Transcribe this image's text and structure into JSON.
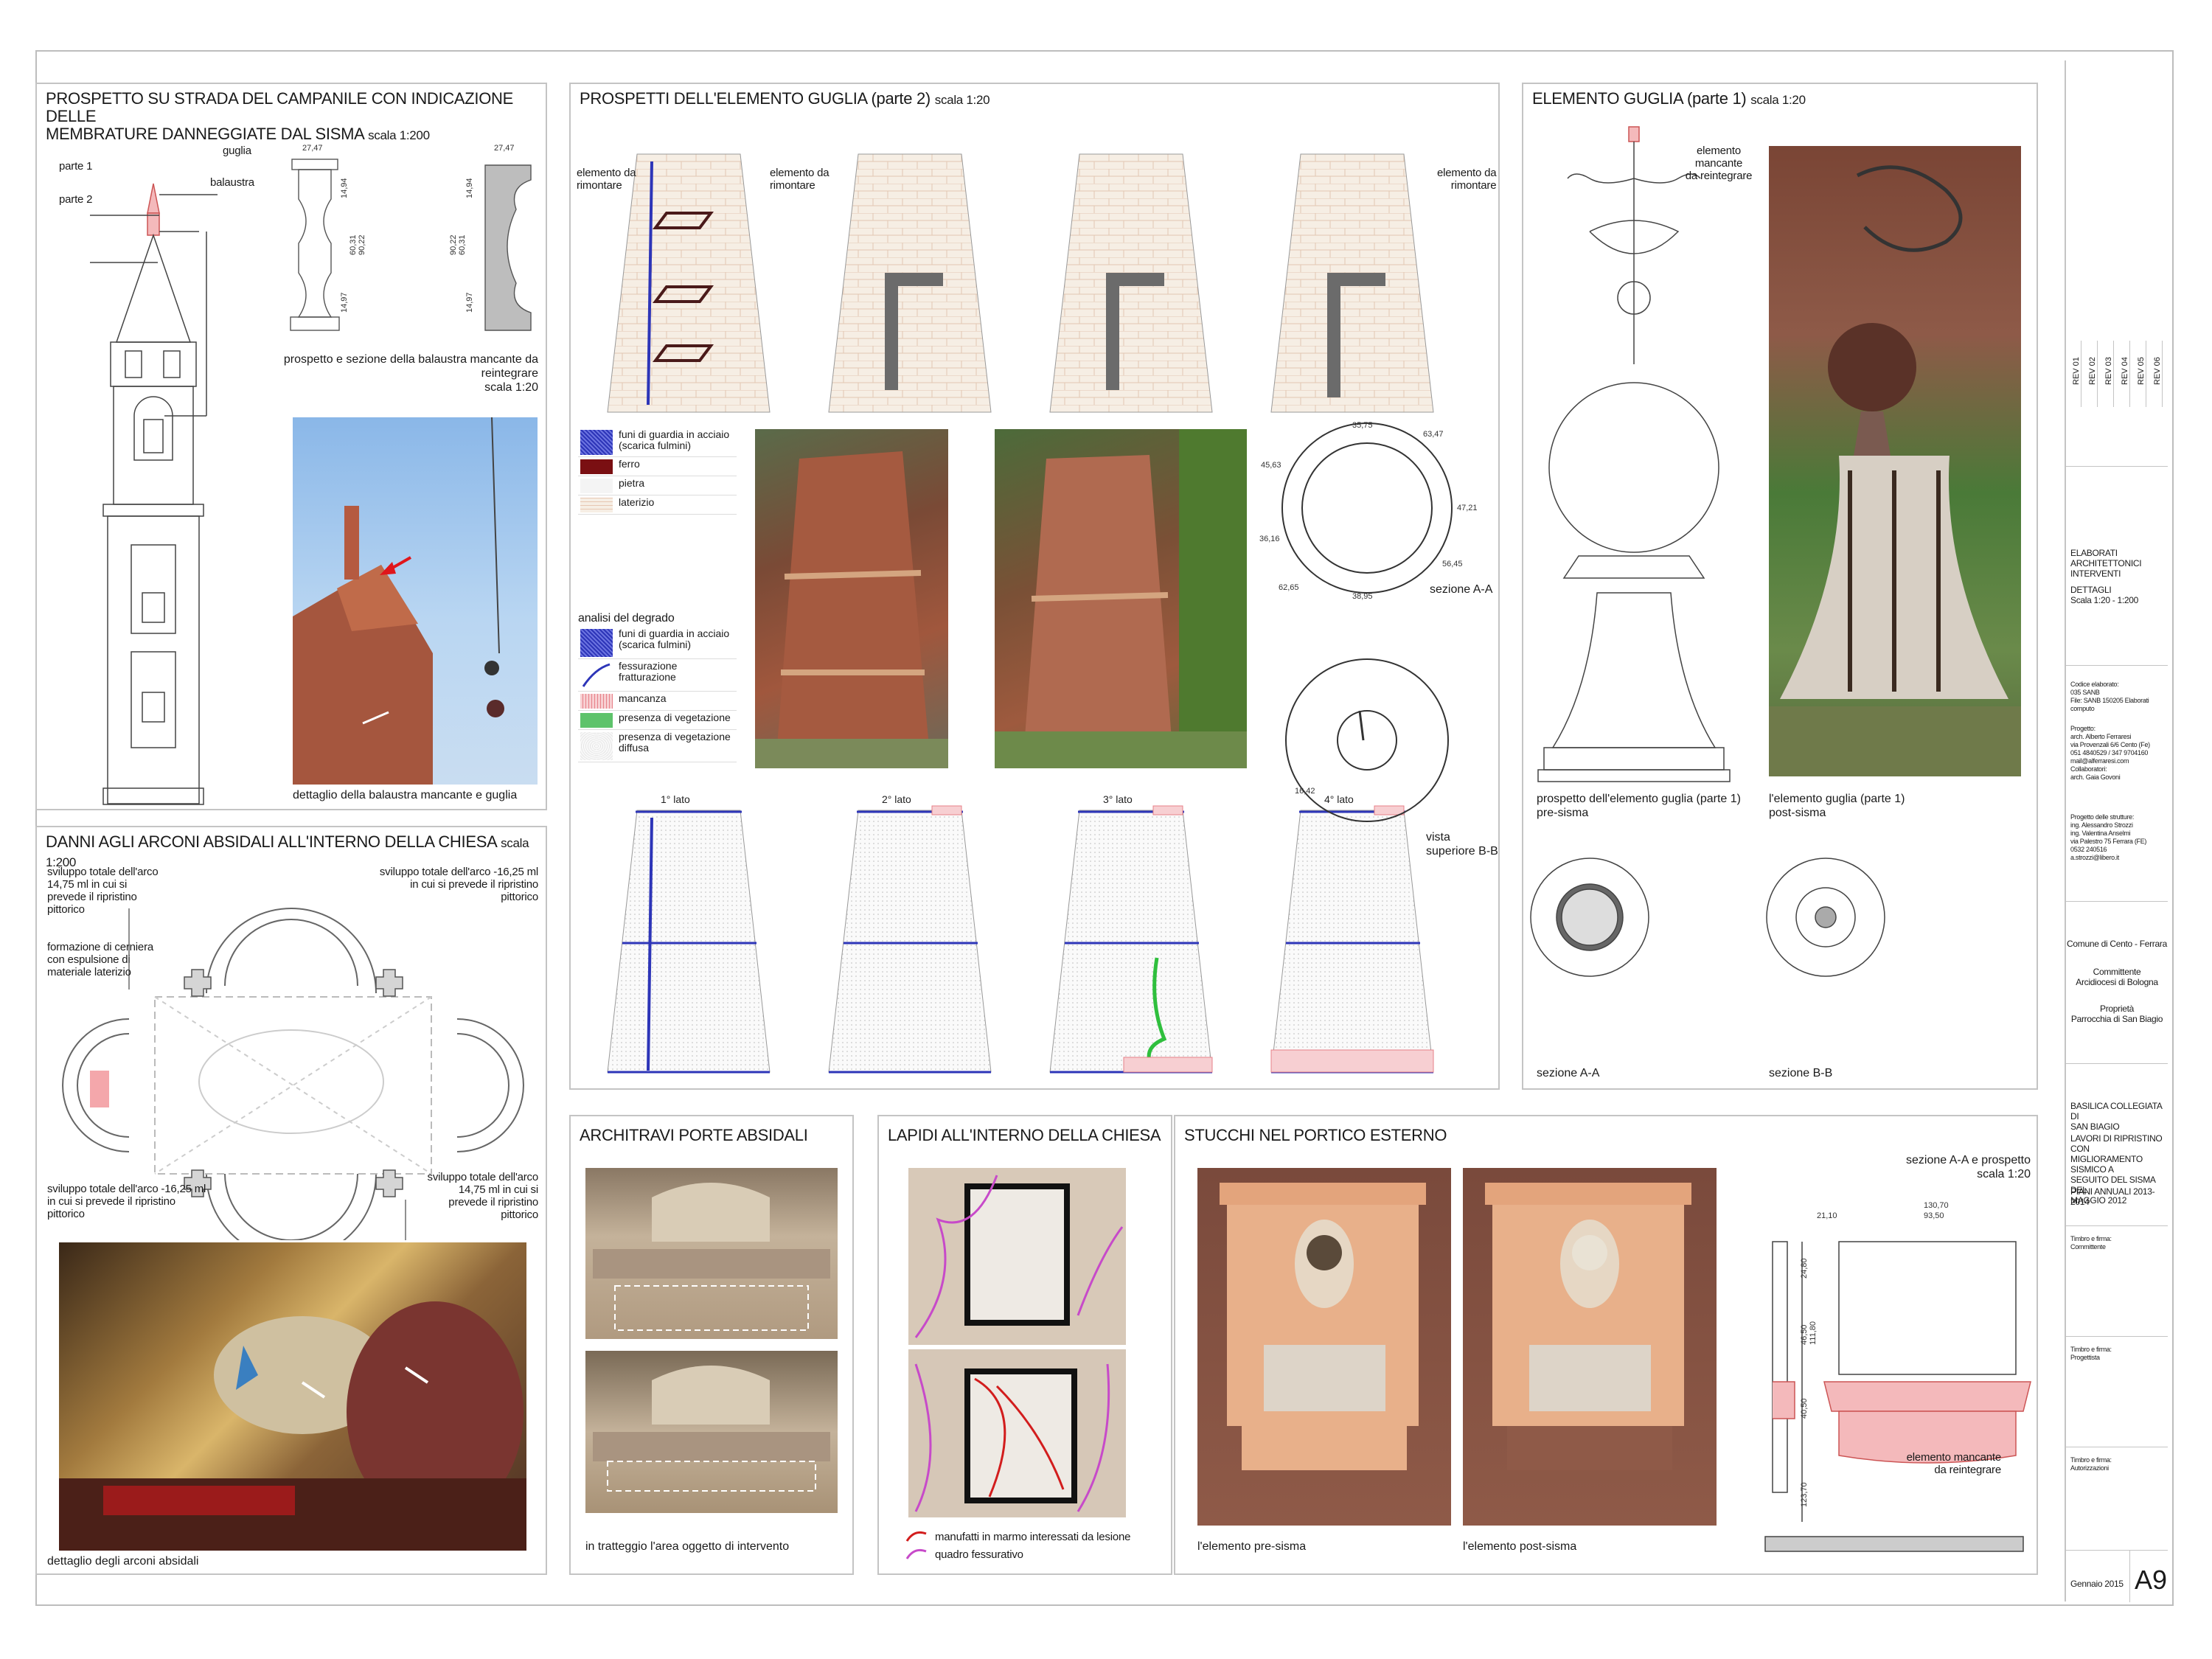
{
  "panel1": {
    "title_line1": "PROSPETTO SU STRADA DEL CAMPANILE CON INDICAZIONE DELLE",
    "title_line2": "MEMBRATURE DANNEGGIATE DAL SISMA",
    "scale": "scala 1:200",
    "labels": {
      "guglia": "guglia",
      "parte1": "parte 1",
      "parte2": "parte 2",
      "balaustra": "balaustra"
    },
    "dims": {
      "d1": "27,47",
      "d2": "27,47",
      "v1": "14,94",
      "v2": "60,31",
      "v3": "90,22",
      "v4": "14,97",
      "v5": "14,94",
      "v6": "90,22",
      "v7": "60,31",
      "v8": "14,97"
    },
    "balaustra_caption1": "prospetto e sezione della balaustra mancante da reintegrare",
    "balaustra_caption2": "scala 1:20",
    "photo_caption": "dettaglio della balaustra mancante e guglia"
  },
  "panel2": {
    "title": "DANNI AGLI ARCONI ABSIDALI ALL'INTERNO DELLA CHIESA",
    "scale": "scala 1:200",
    "note_tl": [
      "sviluppo totale dell'arco",
      "14,75 ml in cui si",
      "prevede il ripristino",
      "pittorico"
    ],
    "note_tr": [
      "sviluppo totale dell'arco -16,25 ml",
      "in cui si prevede il ripristino",
      "pittorico"
    ],
    "note_ml": [
      "formazione di cerniera",
      "con espulsione di",
      "materiale laterizio"
    ],
    "note_bl": [
      "sviluppo totale dell'arco -16,25 ml",
      "in cui si prevede il ripristino",
      "pittorico"
    ],
    "note_br": [
      "sviluppo totale dell'arco",
      "14,75 ml in cui si",
      "prevede il ripristino",
      "pittorico"
    ],
    "photo_caption": "dettaglio degli arconi absidali"
  },
  "panel3": {
    "title": "PROSPETTI  DELL'ELEMENTO GUGLIA (parte 2)",
    "scale": "scala 1:20",
    "sides": [
      "1° lato",
      "2° lato",
      "3° lato",
      "4° lato"
    ],
    "elem_left": [
      "elemento da",
      "rimontare"
    ],
    "elem_mid": [
      "elemento da",
      "rimontare"
    ],
    "elem_right": [
      "elemento da",
      "rimontare"
    ],
    "legend1": [
      "funi di guardia in acciaio (scarica fulmini)",
      "ferro",
      "pietra",
      "laterizio"
    ],
    "analisi_title": "analisi del degrado",
    "legend2": [
      "funi di guardia in acciaio (scarica fulmini)",
      "fessurazione fratturazione",
      "mancanza",
      "presenza di vegetazione",
      "presenza di vegetazione diffusa"
    ],
    "ring_dims": [
      "35,75",
      "63,47",
      "45,63",
      "47,21",
      "36,16",
      "56,45",
      "38,95",
      "62,65"
    ],
    "sezione_aa": "sezione A-A",
    "vista": [
      "vista",
      "superiore B-B"
    ],
    "vista_dim": "16,42",
    "colors": {
      "blue": "#2d35b8",
      "iron": "#7a0f12",
      "brick": "#f6eee4",
      "red": "#e78088",
      "green": "#2fbf3d"
    }
  },
  "panel4": {
    "title": "ELEMENTO GUGLIA (parte 1)",
    "scale": "scala 1:20",
    "elem": [
      "elemento",
      "mancante",
      "da reintegrare"
    ],
    "cap_left": [
      "prospetto dell'elemento guglia (parte 1)",
      "pre-sisma"
    ],
    "cap_right": [
      "l'elemento guglia (parte 1)",
      "post-sisma"
    ],
    "sez_aa": "sezione A-A",
    "sez_bb": "sezione B-B"
  },
  "panel5": {
    "title": "ARCHITRAVI PORTE ABSIDALI",
    "caption": "in tratteggio l'area oggetto di intervento"
  },
  "panel6": {
    "title": "LAPIDI ALL'INTERNO DELLA CHIESA",
    "legend": [
      "manufatti in marmo interessati da lesione",
      "quadro fessurativo"
    ]
  },
  "panel7": {
    "title": "STUCCHI NEL PORTICO ESTERNO",
    "cap_left": "l'elemento pre-sisma",
    "cap_right": "l'elemento post-sisma",
    "sez": [
      "sezione A-A e prospetto",
      "scala 1:20"
    ],
    "dims": [
      "130,70",
      "93,50",
      "21,10",
      "24,80",
      "46,50",
      "111,80",
      "40,50",
      "123,70"
    ],
    "elem": [
      "elemento mancante",
      "da reintegrare"
    ]
  },
  "titleblock": {
    "revs": [
      "REV 01",
      "REV 02",
      "REV 03",
      "REV 04",
      "REV 05",
      "REV 06"
    ],
    "elab": [
      "ELABORATI ARCHITETTONICI",
      "INTERVENTI"
    ],
    "dettagli": [
      "DETTAGLI",
      "Scala 1:20 - 1:200"
    ],
    "codice": [
      "Codice elaborato:",
      "035 SANB",
      "File: SANB 150205 Elaborati computo"
    ],
    "progetto": [
      "Progetto:",
      "arch. Alberto Ferraresi",
      "via Provenzali 6/6 Cento (Fe)",
      "051 4840529 / 347 9704160",
      "mail@alferraresi.com",
      "Collaboratori:",
      "arch. Gaia Govoni"
    ],
    "strutture": [
      "Progetto delle strutture:",
      "ing. Alessandro Strozzi",
      "ing. Valentina Anselmi",
      "via Palestro 75 Ferrara (FE)",
      "0532 240516",
      "a.strozzi@libero.it"
    ],
    "comune": "Comune di Cento - Ferrara",
    "committente": [
      "Committente",
      "Arcidiocesi di Bologna"
    ],
    "proprieta": [
      "Proprietà",
      "Parrocchia di San Biagio"
    ],
    "basilica": [
      "BASILICA COLLEGIATA DI",
      "SAN BIAGIO"
    ],
    "lavori": [
      "LAVORI DI RIPRISTINO CON",
      "MIGLIORAMENTO SISMICO A",
      "SEGUITO DEL SISMA DEL",
      "MAGGIO 2012"
    ],
    "piani": "PIANI ANNUALI 2013-2014",
    "timbro1": [
      "Timbro e firma:",
      "Committente"
    ],
    "timbro2": [
      "Timbro e firma:",
      "Progettista"
    ],
    "timbro3": [
      "Timbro e firma:",
      "Autorizzazioni"
    ],
    "date": "Gennaio 2015",
    "sheet": "A9"
  }
}
